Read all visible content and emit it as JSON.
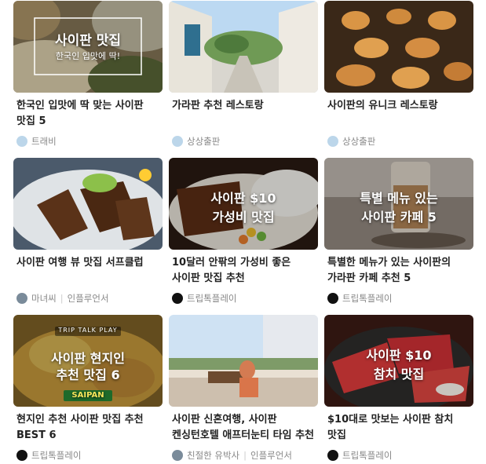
{
  "cards": [
    {
      "overlay_title": "사이판 맛집",
      "overlay_sub": "한국인 입맛에 딱!",
      "title": "한국인 입맛에 딱 맞는 사이판 맛집 5",
      "source": "트래비",
      "badge": ""
    },
    {
      "title": "가라판 추천 레스토랑",
      "source": "상상출판",
      "badge": ""
    },
    {
      "title": "사이판의 유니크 레스토랑",
      "source": "상상출판",
      "badge": ""
    },
    {
      "title": "사이판 여행 뷰 맛집 서프클럽",
      "source": "마녀씨",
      "badge": "인플루언서"
    },
    {
      "overlay_line1": "사이판 $10",
      "overlay_line2": "가성비 맛집",
      "title": "10달러 안팎의 가성비 좋은 사이판 맛집 추천",
      "source": "트립톡플레이",
      "badge": ""
    },
    {
      "overlay_line1": "특별 메뉴 있는",
      "overlay_line2": "사이판 카페 5",
      "title": "특별한 메뉴가 있는 사이판의 가라판 카페 추천 5",
      "source": "트립톡플레이",
      "badge": ""
    },
    {
      "overlay_tag": "TRIP TALK PLAY",
      "overlay_line1": "사이판 현지인",
      "overlay_line2": "추천 맛집 6",
      "overlay_tag2": "SAIPAN",
      "title": "현지인 추천 사이판 맛집 추천 BEST 6",
      "source": "트립톡플레이",
      "badge": ""
    },
    {
      "title": "사이판 신혼여행, 사이판 켄싱턴호텔 애프터눈티 타임 추천",
      "source": "친절한 유박사",
      "badge": "인플루언서"
    },
    {
      "overlay_line1": "사이판 $10",
      "overlay_line2": "참치 맛집",
      "title": "$10대로 맛보는 사이판 참치 맛집",
      "source": "트립톡플레이",
      "badge": ""
    }
  ]
}
